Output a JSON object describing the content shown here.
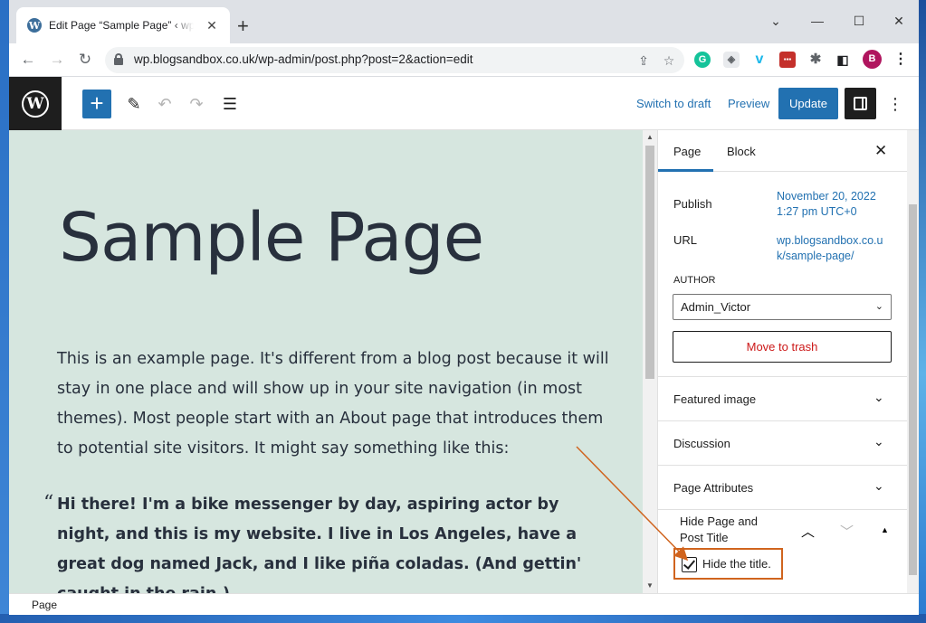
{
  "browser": {
    "tab_title": "Edit Page “Sample Page” ‹ wp.blogsandbox.co.uk — WordPress",
    "url": "wp.blogsandbox.co.uk/wp-admin/post.php?post=2&action=edit",
    "profile_initial": "B"
  },
  "editor_header": {
    "switch_to_draft": "Switch to draft",
    "preview": "Preview",
    "update": "Update"
  },
  "content": {
    "title": "Sample Page",
    "paragraph": "This is an example page. It's different from a blog post because it will stay in one place and will show up in your site navigation (in most themes). Most people start with an About page that introduces them to potential site visitors. It might say something like this:",
    "quote_mark": "“",
    "quote": "Hi there! I'm a bike messenger by day, aspiring actor by night, and this is my website. I live in Los Angeles, have a great dog named Jack, and I like piña coladas. (And gettin' caught in the rain.)"
  },
  "sidebar": {
    "tabs": [
      "Page",
      "Block"
    ],
    "publish_label": "Publish",
    "publish_value": "November 20, 2022 1:27 pm UTC+0",
    "url_label": "URL",
    "url_value": "wp.blogsandbox.co.uk/sample-page/",
    "author_label": "AUTHOR",
    "author_value": "Admin_Victor",
    "trash_button": "Move to trash",
    "panels": [
      "Featured image",
      "Discussion",
      "Page Attributes"
    ],
    "hide_title_panel": "Hide Page and Post Title",
    "hide_title_checkbox": "Hide the title.",
    "hide_title_checked": true
  },
  "footer": {
    "breadcrumb": "Page"
  },
  "colors": {
    "wp_blue": "#2271b1",
    "canvas_bg": "#d6e6df",
    "annotation": "#d0641e"
  }
}
